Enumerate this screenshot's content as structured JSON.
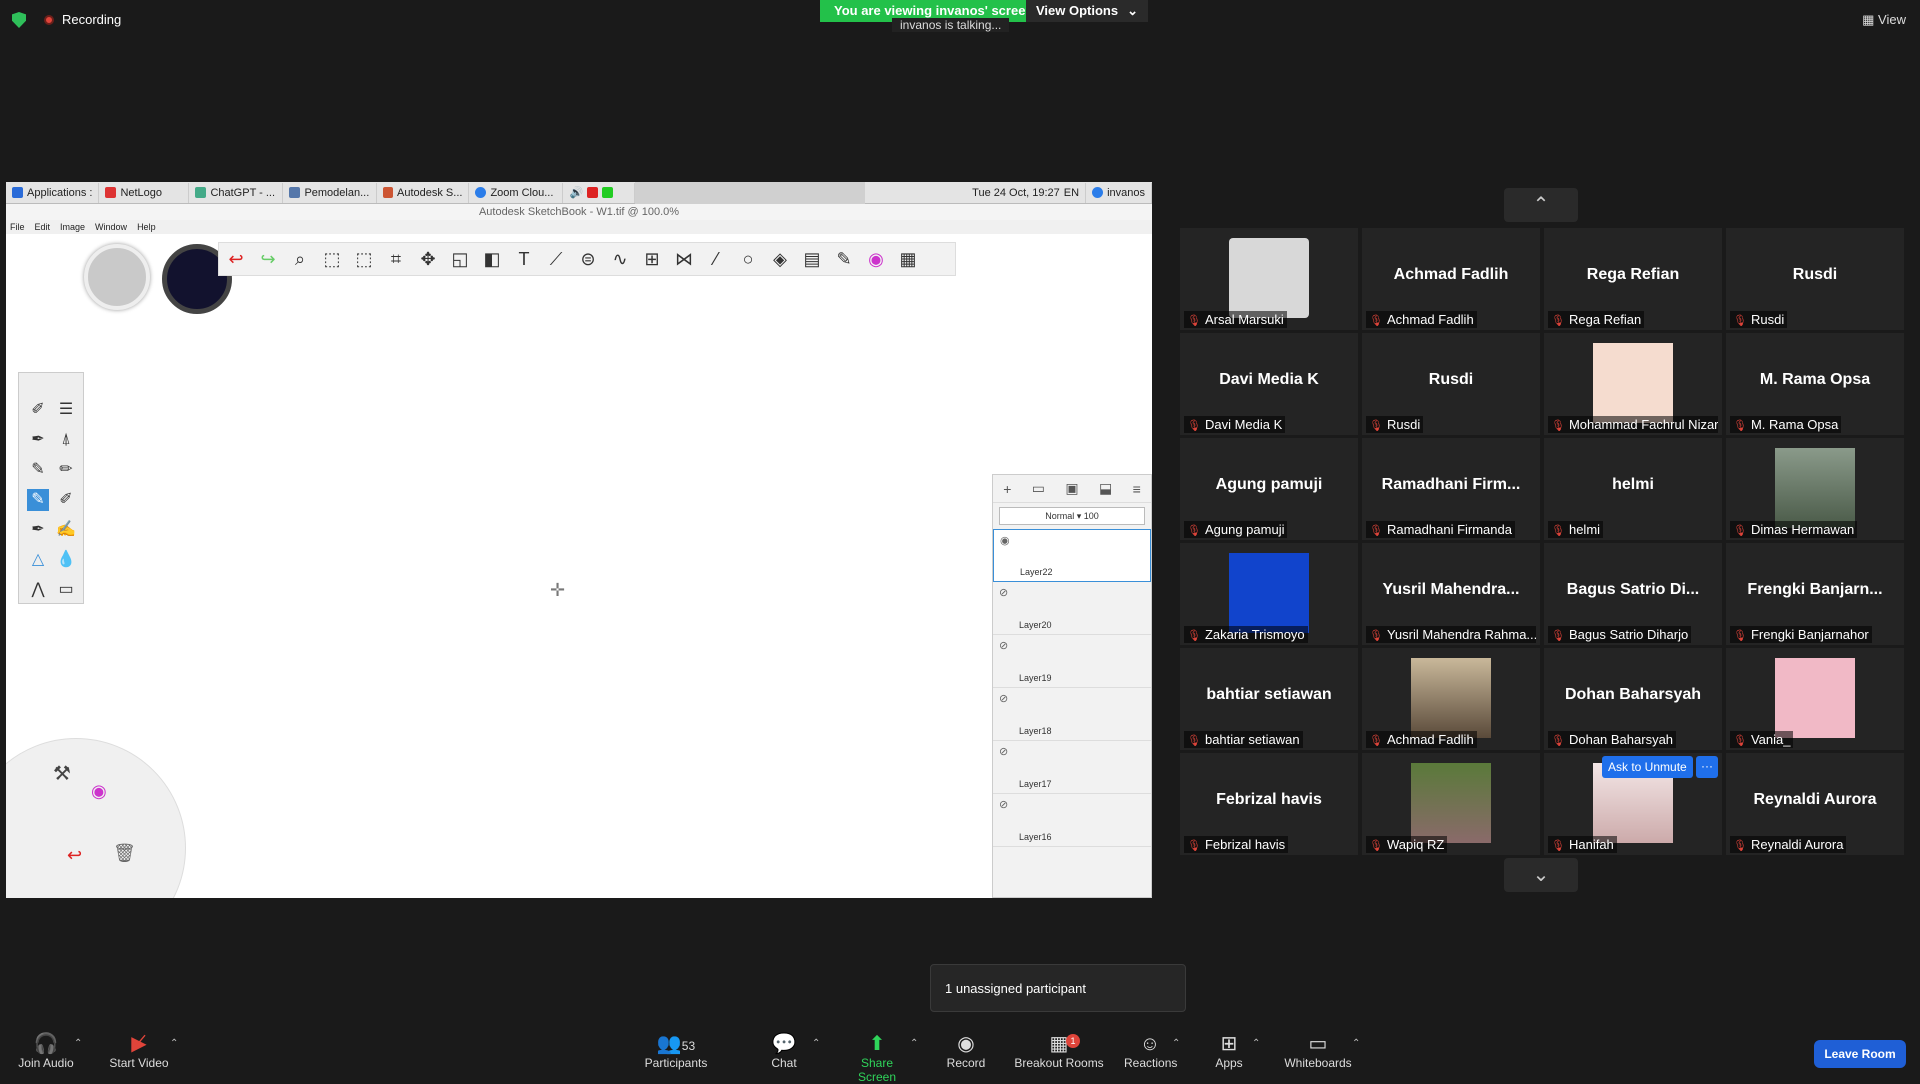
{
  "meeting": {
    "recording": "Recording",
    "banner": "You are viewing invanos' screen",
    "view_options": "View Options",
    "talking": "invanos is talking...",
    "view": "View",
    "notice": "1 unassigned participant",
    "ask_unmute": "Ask to Unmute",
    "leave": "Leave Room"
  },
  "taskbar": {
    "items": [
      "Applications :",
      "NetLogo",
      "ChatGPT - ...",
      "Pemodelan...",
      "Autodesk S...",
      "Zoom Clou..."
    ],
    "datetime": "Tue 24 Oct, 19:27",
    "lang": "EN",
    "user": "invanos"
  },
  "sketchbook": {
    "title": "Autodesk SketchBook - W1.tif @ 100.0%",
    "menu": [
      "File",
      "Edit",
      "Image",
      "Window",
      "Help"
    ],
    "blend_mode": "Normal",
    "opacity": "100",
    "layers": [
      "Layer22",
      "Layer20",
      "Layer19",
      "Layer18",
      "Layer17",
      "Layer16"
    ]
  },
  "participants": [
    {
      "big": "",
      "label": "Arsal Marsuki",
      "photo": "avatar"
    },
    {
      "big": "Achmad Fadlih",
      "label": "Achmad Fadlih"
    },
    {
      "big": "Rega Refian",
      "label": "Rega Refian"
    },
    {
      "big": "Rusdi",
      "label": "Rusdi"
    },
    {
      "big": "Davi Media K",
      "label": "Davi Media K"
    },
    {
      "big": "Rusdi",
      "label": "Rusdi"
    },
    {
      "big": "",
      "label": "Mohammad Fachrul Nizar",
      "photo": "youcan"
    },
    {
      "big": "M. Rama Opsa",
      "label": "M. Rama Opsa"
    },
    {
      "big": "Agung pamuji",
      "label": "Agung pamuji"
    },
    {
      "big": "Ramadhani  Firm...",
      "label": "Ramadhani Firmanda"
    },
    {
      "big": "helmi",
      "label": "helmi"
    },
    {
      "big": "",
      "label": "Dimas Hermawan",
      "photo": "forest"
    },
    {
      "big": "",
      "label": "Zakaria Trismoyo",
      "photo": "portrait"
    },
    {
      "big": "Yusril  Mahendra...",
      "label": "Yusril Mahendra Rahma..."
    },
    {
      "big": "Bagus Satrio Di...",
      "label": "Bagus Satrio Diharjo"
    },
    {
      "big": "Frengki  Banjarn...",
      "label": "Frengki Banjarnahor"
    },
    {
      "big": "bahtiar setiawan",
      "label": "bahtiar setiawan"
    },
    {
      "big": "",
      "label": "Achmad Fadlih",
      "photo": "suit"
    },
    {
      "big": "Dohan Baharsyah",
      "label": "Dohan Baharsyah"
    },
    {
      "big": "",
      "label": "Vania_",
      "photo": "pink"
    },
    {
      "big": "Febrizal havis",
      "label": "Febrizal havis"
    },
    {
      "big": "",
      "label": "Wapiq RZ",
      "photo": "garden"
    },
    {
      "big": "",
      "label": "Hanifah",
      "photo": "girls"
    },
    {
      "big": "Reynaldi Aurora",
      "label": "Reynaldi Aurora"
    }
  ],
  "toolbar": {
    "join_audio": "Join Audio",
    "start_video": "Start Video",
    "participants": "Participants",
    "participants_count": "53",
    "chat": "Chat",
    "share": "Share Screen",
    "record": "Record",
    "breakout": "Breakout Rooms",
    "breakout_badge": "1",
    "reactions": "Reactions",
    "apps": "Apps",
    "whiteboards": "Whiteboards"
  },
  "colors": {
    "green": "#23c14a",
    "red": "#e0443a",
    "blue": "#1f6feb"
  }
}
